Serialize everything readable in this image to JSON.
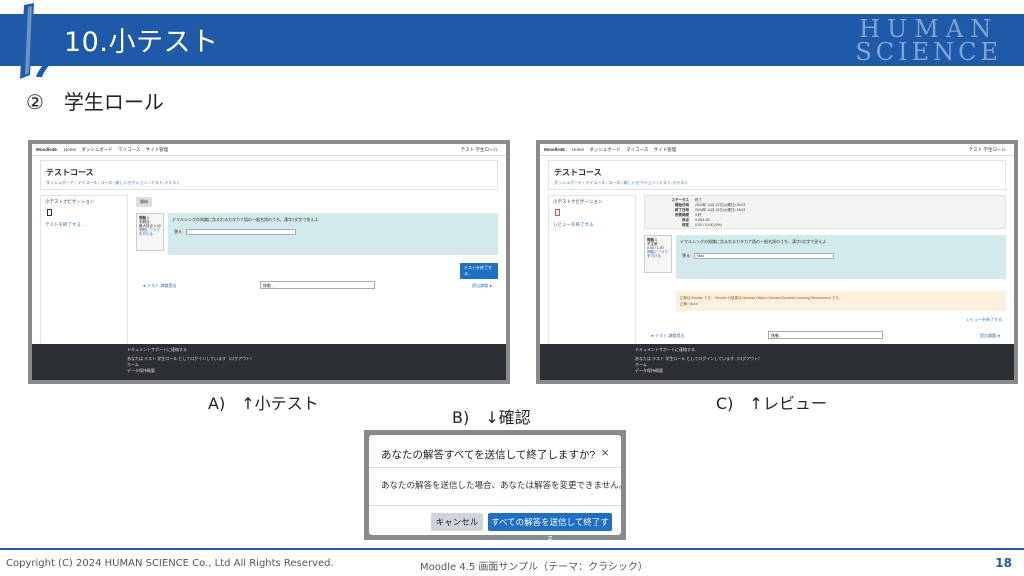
{
  "slide": {
    "title": "10.小テスト",
    "subtitle": "②　学生ロール",
    "brand_line1": "HUMAN",
    "brand_line2": "SCIENCE",
    "page_number": "18",
    "copyright": "Copyright (C) 2024 HUMAN SCIENCE Co., Ltd All Rights Reserved.",
    "footer_note": "Moodle 4.5 画面サンプル（テーマ：クラシック）"
  },
  "colors": {
    "brand_blue": "#1f5aa8",
    "button_blue": "#1f6fc5",
    "question_bg": "#d3eaec",
    "feedback_bg": "#fcefdc",
    "footer_dark": "#2c2f33"
  },
  "labels": {
    "a": "A)　↑小テスト",
    "b": "B)　↓確認",
    "c": "C)　↑レビュー"
  },
  "moodle": {
    "brand": "Moodle45",
    "nav": [
      "Home",
      "ダッシュボード",
      "マイコース",
      "サイト管理"
    ],
    "user": "テスト 学生ロール",
    "course_title": "テストコース",
    "breadcrumb": "ダッシュボード / マイコース / コース / 新しいセクション / テスト-小テスト",
    "quiz_nav_title": "小テストナビゲーション",
    "finish_attempt_link": "テストを終了する ...",
    "finish_review_link": "レビューを終了する",
    "timer_label": "開始",
    "qinfo_title": "問題 1",
    "qinfo_status": "未解答",
    "qinfo_points": "最大評点 1.00",
    "qinfo_flag": "問題にフラグを付ける",
    "review_qinfo_status": "不正解",
    "review_qinfo_points": "0.00 / 1.00",
    "question_text": "デマルシングの知識に含まれるカタカナ語の一般名詞のうち、漢字2文字で答えよ",
    "answer_label": "答え:",
    "review_answer": "Moo",
    "finish_button": "テストを終了する...",
    "prev_link": "◄ テスト-課題提出",
    "jump_placeholder": "移動...",
    "next_link": "提出課題 ►",
    "footer_items": [
      "ドキュメントサポートに連絡する",
      "あなたは テスト 学生ロール としてログインしています（ログアウト）",
      "ホーム",
      "データ保持概要"
    ],
    "summary": [
      {
        "k": "ステータス",
        "v": "終了"
      },
      {
        "k": "開始日時",
        "v": "2024年 11月 12日(火曜日) 18:03"
      },
      {
        "k": "終了日時",
        "v": "2024年 11月 12日(火曜日) 18:03"
      },
      {
        "k": "所要時間",
        "v": "9 秒"
      },
      {
        "k": "評点",
        "v": "0.00/1.00"
      },
      {
        "k": "評定",
        "v": "0.00 / 10.00 (0%)"
      }
    ],
    "feedback_line1": "正解は Moodle です。 Moodle の語源は Modular Object-Oriented Dynamic Learning Environment です。",
    "feedback_line2": "正解: Mood"
  },
  "dialog": {
    "title": "あなたの解答すべてを送信して終了しますか?",
    "close": "×",
    "body": "あなたの解答を送信した場合、あなたは解答を変更できません。",
    "cancel": "キャンセル",
    "submit": "すべての解答を送信して終了する"
  }
}
